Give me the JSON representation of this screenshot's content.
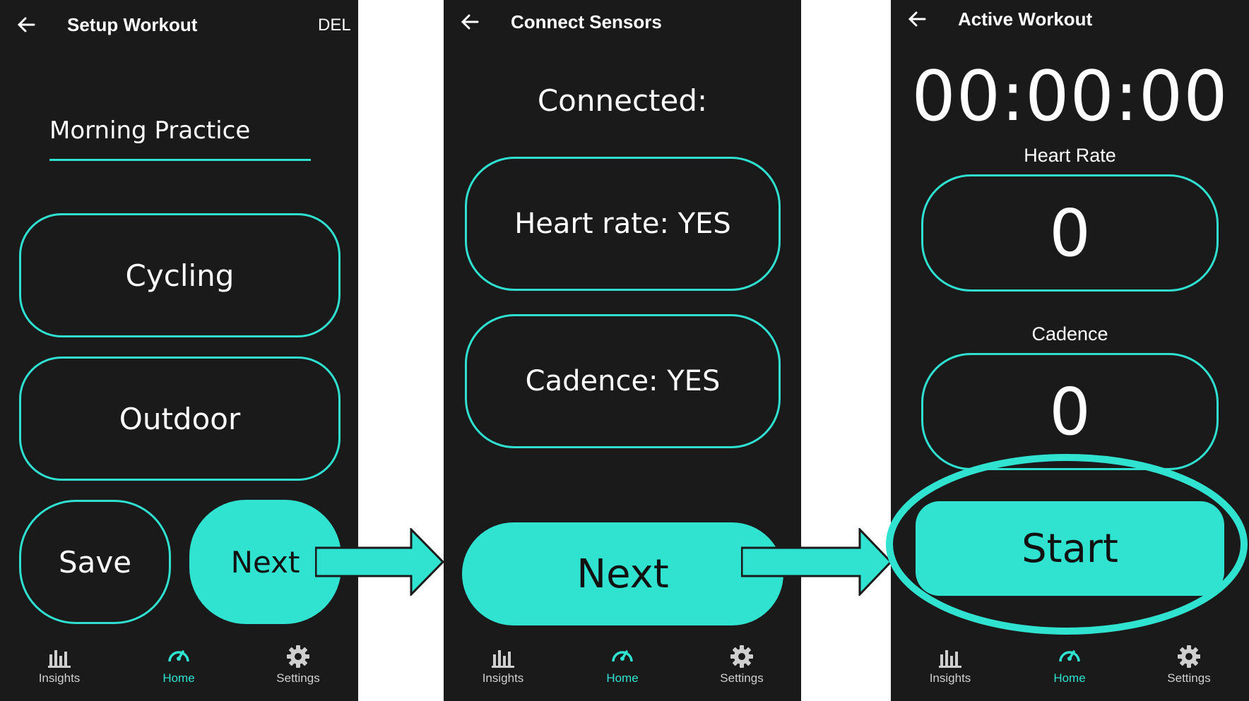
{
  "screen1": {
    "title": "Setup Workout",
    "del_label": "DEL",
    "workout_name": "Morning Practice",
    "sport_option": "Cycling",
    "environment_option": "Outdoor",
    "save_label": "Save",
    "next_label": "Next"
  },
  "screen2": {
    "title": "Connect Sensors",
    "connected_label": "Connected:",
    "heart_rate_status": "Heart rate: YES",
    "cadence_status": "Cadence: YES",
    "next_label": "Next"
  },
  "screen3": {
    "title": "Active Workout",
    "timer": "00:00:00",
    "heart_rate_label": "Heart Rate",
    "heart_rate_value": "0",
    "cadence_label": "Cadence",
    "cadence_value": "0",
    "start_label": "Start"
  },
  "bottom_nav": {
    "insights": "Insights",
    "home": "Home",
    "settings": "Settings"
  },
  "colors": {
    "accent": "#30e3d1",
    "background": "#1a1a1a",
    "text": "#ffffff"
  },
  "icons": [
    "back-arrow-icon",
    "bar-chart-icon",
    "speedometer-icon",
    "gear-icon",
    "flow-arrow-icon"
  ]
}
